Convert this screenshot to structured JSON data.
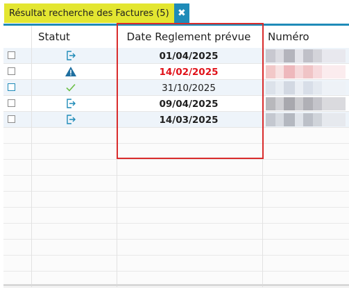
{
  "tab": {
    "label": "Résultat recherche des Factures (5)",
    "close_glyph": "✖"
  },
  "columns": {
    "statut": "Statut",
    "date": "Date Reglement prévue",
    "numero": "Numéro"
  },
  "rows": [
    {
      "status": "export-icon",
      "date": "01/04/2025",
      "style": "bold"
    },
    {
      "status": "warning-icon",
      "date": "14/02/2025",
      "style": "red"
    },
    {
      "status": "check-icon",
      "date": "31/10/2025",
      "style": "normal"
    },
    {
      "status": "export-icon",
      "date": "09/04/2025",
      "style": "bold"
    },
    {
      "status": "export-icon",
      "date": "14/03/2025",
      "style": "bold"
    }
  ],
  "colors": {
    "tab_bg": "#e3e631",
    "accent": "#1f8bb8",
    "due_late": "#e0121a",
    "check": "#6abf45",
    "highlight_box": "#d92b2b"
  }
}
